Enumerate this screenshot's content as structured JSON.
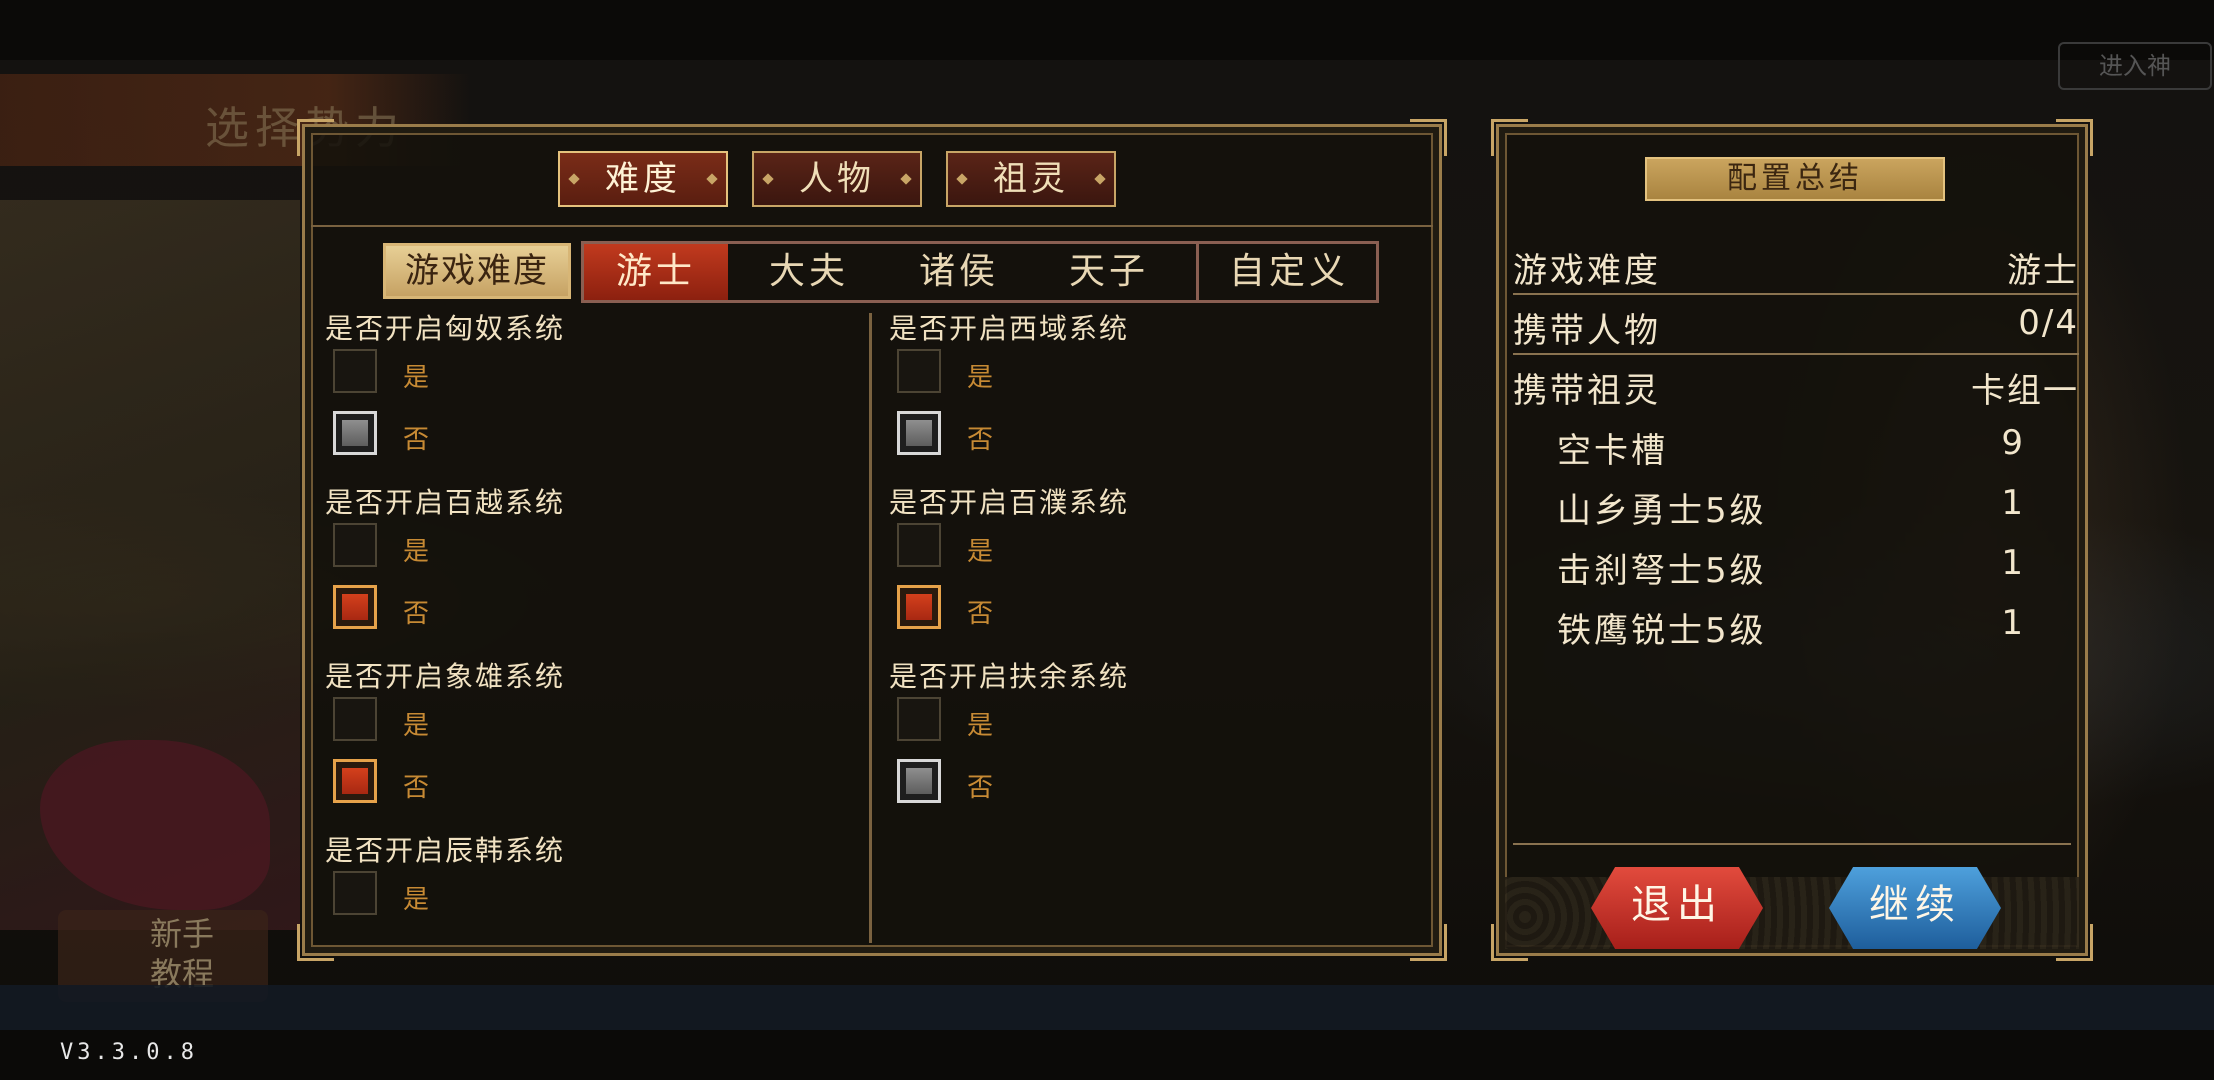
{
  "background": {
    "banner_title": "选择势力",
    "tutorial_label": "新手教程",
    "top_right_button": "进入神"
  },
  "top_tabs": [
    {
      "label": "难度",
      "active": true
    },
    {
      "label": "人物",
      "active": false
    },
    {
      "label": "祖灵",
      "active": false
    }
  ],
  "difficulty": {
    "label": "游戏难度",
    "options": [
      {
        "label": "游士",
        "active": true
      },
      {
        "label": "大夫",
        "active": false
      },
      {
        "label": "诸侯",
        "active": false
      },
      {
        "label": "天子",
        "active": false
      },
      {
        "label": "自定义",
        "active": false
      }
    ]
  },
  "option_labels": {
    "yes": "是",
    "no": "否"
  },
  "systems": [
    {
      "title": "是否开启匈奴系统",
      "selected": "no",
      "style": "gray"
    },
    {
      "title": "是否开启西域系统",
      "selected": "no",
      "style": "gray"
    },
    {
      "title": "是否开启百越系统",
      "selected": "no",
      "style": "orange"
    },
    {
      "title": "是否开启百濮系统",
      "selected": "no",
      "style": "orange"
    },
    {
      "title": "是否开启象雄系统",
      "selected": "no",
      "style": "orange"
    },
    {
      "title": "是否开启扶余系统",
      "selected": "no",
      "style": "gray"
    },
    {
      "title": "是否开启辰韩系统",
      "selected": "none",
      "style": "none"
    }
  ],
  "summary": {
    "title": "配置总结",
    "rows": [
      {
        "key": "游戏难度",
        "value": "游士"
      },
      {
        "key": "携带人物",
        "value": "0/4"
      },
      {
        "key": "携带祖灵",
        "value": "卡组一"
      }
    ],
    "cards": [
      {
        "name": "空卡槽",
        "count": "9"
      },
      {
        "name": "山乡勇士5级",
        "count": "1"
      },
      {
        "name": "击刹弩士5级",
        "count": "1"
      },
      {
        "name": "铁鹰锐士5级",
        "count": "1"
      }
    ]
  },
  "buttons": {
    "exit": "退出",
    "continue": "继续"
  },
  "version": "V3.3.0.8",
  "colors": {
    "accent_red": "#c13a1e",
    "gold": "#c8a566",
    "exit": "#e24b3d",
    "continue": "#4ea0dc"
  }
}
